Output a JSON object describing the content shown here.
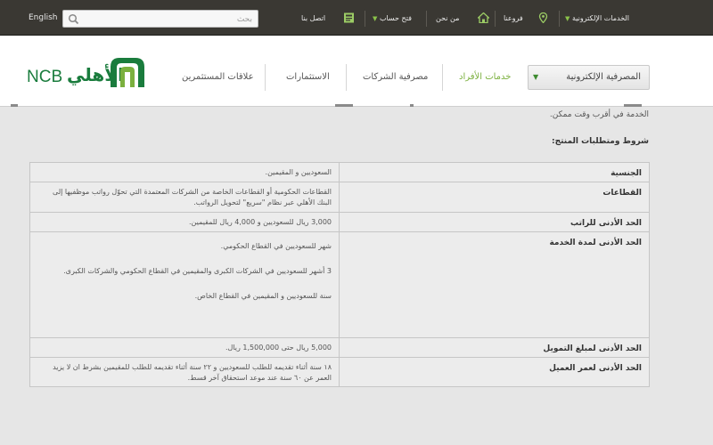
{
  "topbar": {
    "english_label": "English",
    "search_placeholder": "بحث",
    "nav": {
      "e_services": "الخدمات الإلكترونية",
      "branches": "فروعنا",
      "about": "من نحن",
      "open_account": "فتح حساب",
      "contact": "اتصل بنا"
    }
  },
  "header": {
    "logo_ar": "الأهلي",
    "logo_en": "NCB",
    "nav": {
      "e_banking": "المصرفية الإلكترونية",
      "personal": "خدمات الأفراد",
      "corporate": "مصرفية الشركات",
      "investments": "الاستثمارات",
      "investor_relations": "علاقات المستثمرين"
    }
  },
  "content": {
    "intro_tail": "الخدمة في أقرب وقت ممكن.",
    "section_title": "شروط ومتطلبات المنتج:",
    "rows": [
      {
        "label": "الجنسية",
        "lines": [
          "السعوديين و المقيمين."
        ]
      },
      {
        "label": "القطاعات",
        "lines": [
          "القطاعات الحكومية أو القطاعات الخاصة من الشركات المعتمدة التي تحوّل رواتب موظفيها إلى البنك الأهلي عبر نظام \"سريع\" لتحويل الرواتب."
        ]
      },
      {
        "label": "الحد الأدنى للراتب",
        "lines": [
          "3,000 ريال للسعوديين و 4,000 ريال للمقيمين."
        ]
      },
      {
        "label": "الحد الأدنى لمدة الخدمة",
        "lines": [
          "شهر للسعوديين في القطاع الحكومي.",
          "3 أشهر للسعوديين في الشركات الكبرى والمقيمين في القطاع الحكومي والشركات الكبرى.",
          "سنة للسعوديين و المقيمين في القطاع الخاص."
        ]
      },
      {
        "label": "الحد الأدنى لمبلغ التمويل",
        "lines": [
          "5,000 ريال حتى 1,500,000 ريال."
        ]
      },
      {
        "label": "الحد الأدنى لعمر العميل",
        "lines": [
          "١٨ سنة أثناء تقديمه للطلب للسعوديين و ٢٢ سنة أثناء تقديمه للطلب للمقيمين بشرط ان لا يزيد العمر عن ٦٠ سنة عند موعد استحقاق آخر قسط."
        ]
      }
    ]
  },
  "colors": {
    "topbar": "#3a3833",
    "brand_green": "#1a7c3d",
    "accent_green": "#7bb03e",
    "page_bg": "#e6e6e6",
    "table_cell": "#ececec"
  }
}
